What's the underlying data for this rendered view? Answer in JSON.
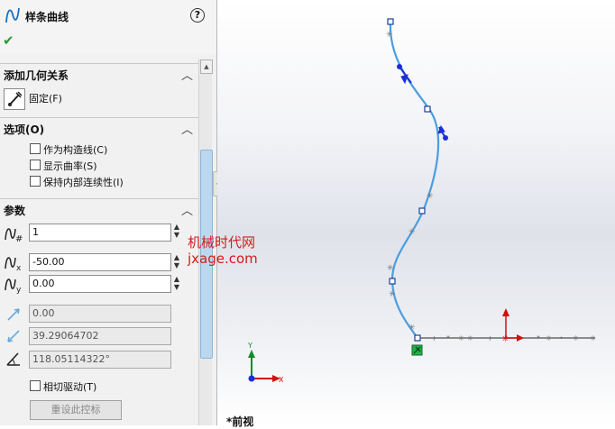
{
  "header": {
    "title": "样条曲线",
    "help": "?",
    "ok": "✔"
  },
  "sections": {
    "relations": {
      "label": "添加几何关系",
      "fixed_label": "固定(F)"
    },
    "options": {
      "label": "选项(O)",
      "items": [
        "作为构造线(C)",
        "显示曲率(S)",
        "保持内部连续性(I)"
      ]
    },
    "parameters": {
      "label": "参数",
      "point_number": "1",
      "x_value": "-50.00",
      "y_value": "0.00",
      "ro1": "0.00",
      "ro2": "39.29064702",
      "ro3": "118.05114322°",
      "tangent_driving": "相切驱动(T)",
      "reset_button": "重设此控标"
    }
  },
  "watermark": {
    "line1": "机械时代网",
    "line2": "jxage.com"
  },
  "viewport": {
    "view_label": "*前视",
    "axis_x": "X",
    "axis_y": "Y"
  },
  "colors": {
    "spline": "#4a9ee0",
    "handle": "#1a2fd6",
    "origin": "#d01010",
    "check": "#2e9a2e"
  }
}
